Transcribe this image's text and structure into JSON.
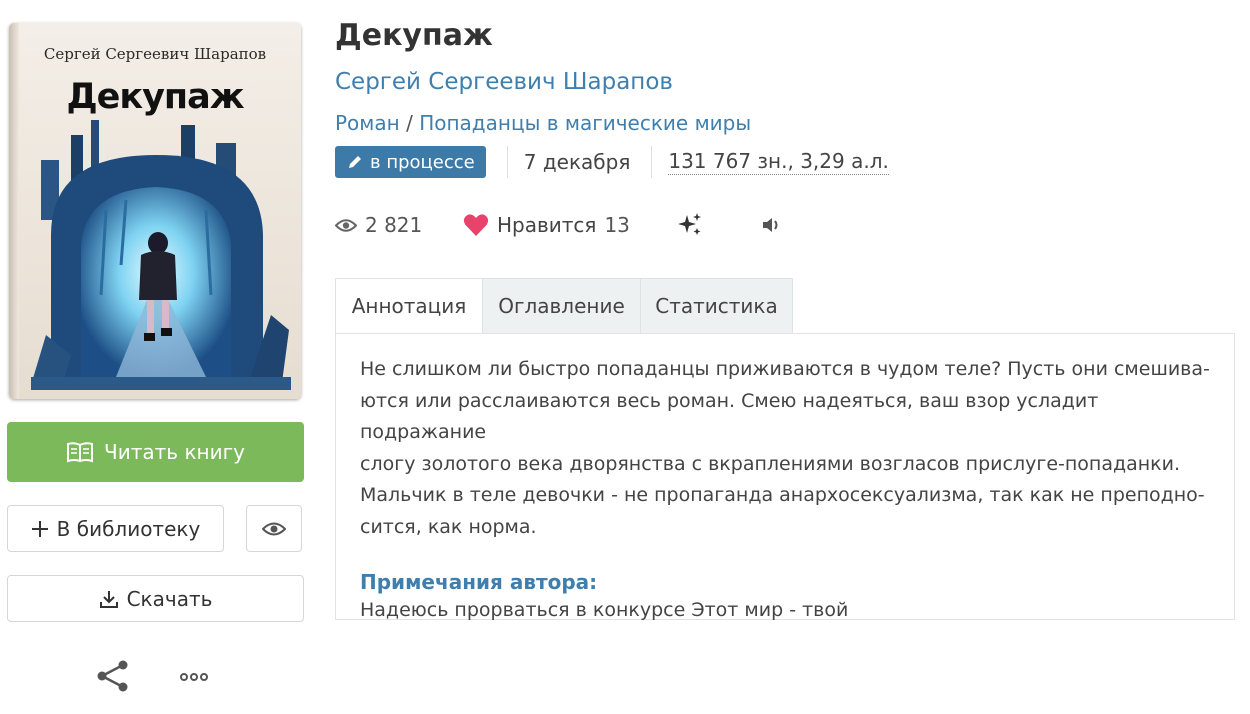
{
  "cover": {
    "author": "Сергей Сергеевич Шарапов",
    "title": "Декупаж"
  },
  "actions": {
    "read_label": "Читать книгу",
    "library_label": "В библиотеку",
    "download_label": "Скачать"
  },
  "book": {
    "title": "Декупаж",
    "author": "Сергей Сергеевич Шарапов",
    "genre": "Роман",
    "genre_separator": "/",
    "subgenre": "Попаданцы в магические миры",
    "status": "в процессе",
    "date": "7 декабря",
    "size": "131 767 зн., 3,29 а.л."
  },
  "stats": {
    "views": "2 821",
    "likes_label": "Нравится",
    "likes": "13"
  },
  "tabs": [
    {
      "label": "Аннотация",
      "active": true
    },
    {
      "label": "Оглавление",
      "active": false
    },
    {
      "label": "Статистика",
      "active": false
    }
  ],
  "annotation": {
    "lines": [
      "Не слишком ли быстро попаданцы приживаются в чудом теле? Пусть они смешива-",
      "ются или расслаиваются весь роман. Смею надеяться, ваш взор усладит подражание",
      "слогу золотого века дворянства с вкраплениями возгласов прислуге-попаданки.",
      "Мальчик в теле девочки - не пропаганда анархосексуализма, так как не преподно-",
      "сится, как норма."
    ],
    "notes_title": "Примечания автора:",
    "notes_text": "Надеюсь прорваться в конкурсе Этот мир - твой"
  },
  "colors": {
    "accent": "#3f7fae",
    "read_button": "#7cb95b",
    "status_badge": "#3d7aa7",
    "like_heart": "#e8436a"
  },
  "icons": [
    "book-open-icon",
    "plus-icon",
    "eye-icon",
    "download-icon",
    "share-icon",
    "more-dots-icon",
    "pencil-icon",
    "views-eye-icon",
    "heart-icon",
    "sparkle-icon",
    "speaker-icon"
  ]
}
